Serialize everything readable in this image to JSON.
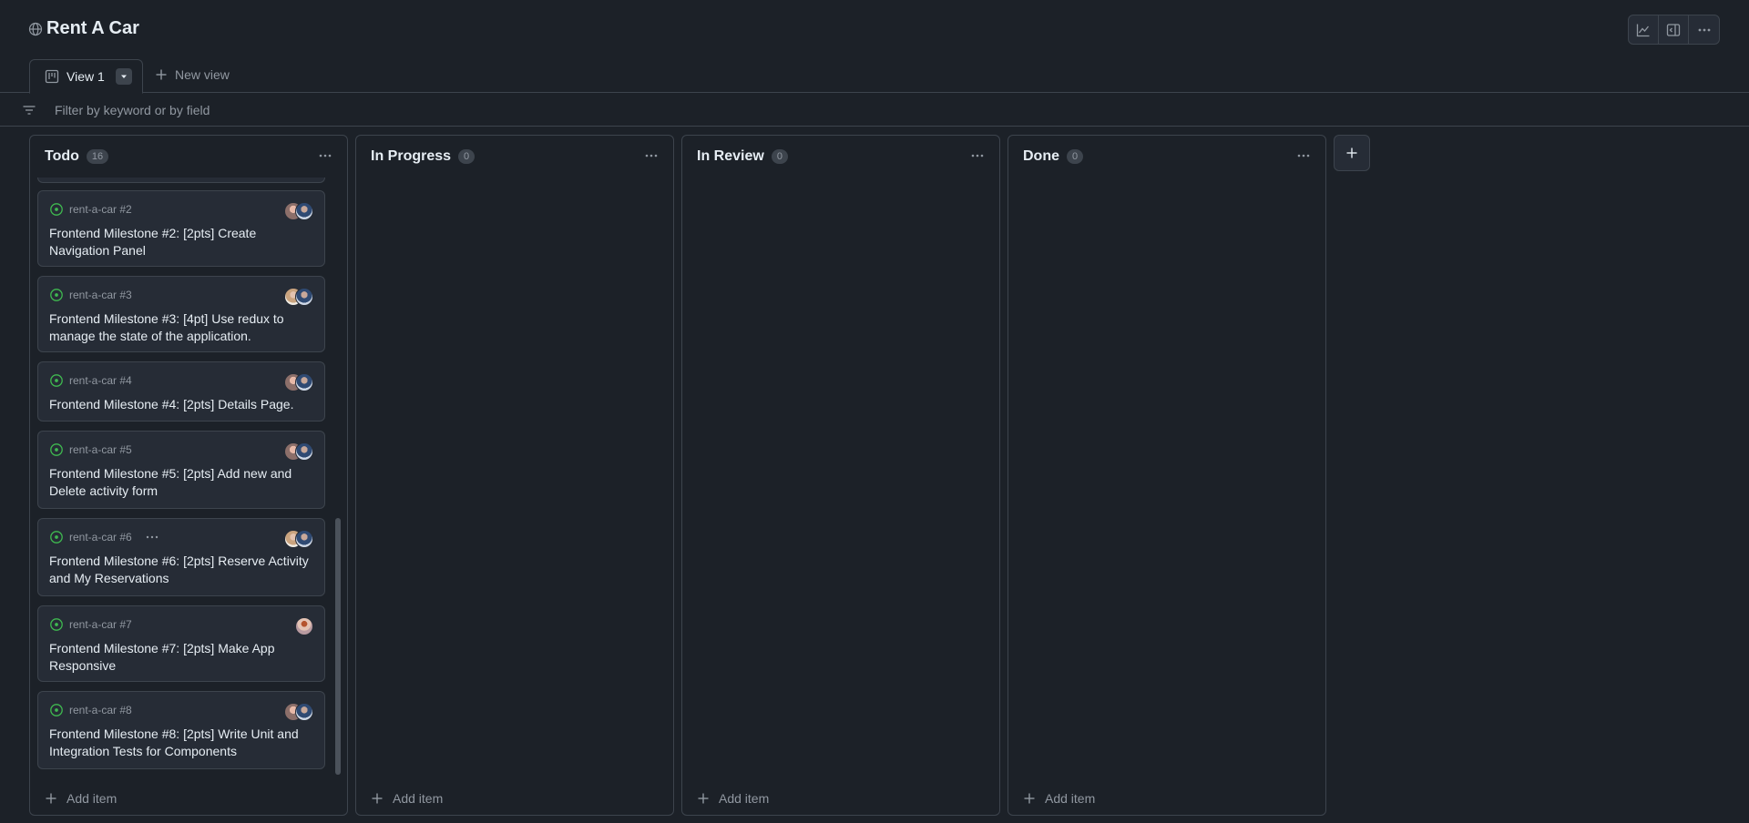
{
  "header": {
    "title": "Rent A Car",
    "icons": [
      "globe-icon",
      "graph-icon",
      "sidebar-icon",
      "kebab-horizontal-icon"
    ]
  },
  "tabs": {
    "active_label": "View 1",
    "new_view_label": "New view"
  },
  "filter": {
    "placeholder": "Filter by keyword or by field"
  },
  "columns": [
    {
      "name": "Todo",
      "count": "16",
      "add_label": "Add item",
      "cards": [
        {
          "ref": "rent-a-car #2",
          "title": "Frontend Milestone #2: [2pts] Create Navigation Panel",
          "avatars": [
            "a1",
            "a2"
          ]
        },
        {
          "ref": "rent-a-car #3",
          "title": "Frontend Milestone #3: [4pt] Use redux to manage the state of the application.",
          "avatars": [
            "a3",
            "a2"
          ]
        },
        {
          "ref": "rent-a-car #4",
          "title": "Frontend Milestone #4: [2pts] Details Page.",
          "avatars": [
            "a1",
            "a2"
          ]
        },
        {
          "ref": "rent-a-car #5",
          "title": "Frontend Milestone #5: [2pts] Add new and Delete activity form",
          "avatars": [
            "a1",
            "a2"
          ]
        },
        {
          "ref": "rent-a-car #6",
          "title": "Frontend Milestone #6: [2pts] Reserve Activity and My Reservations",
          "avatars": [
            "a3",
            "a2"
          ]
        },
        {
          "ref": "rent-a-car #7",
          "title": "Frontend Milestone #7: [2pts] Make App Responsive",
          "avatars": [
            "a4"
          ]
        },
        {
          "ref": "rent-a-car #8",
          "title": "Frontend Milestone #8: [2pts] Write Unit and Integration Tests for Components",
          "avatars": [
            "a1",
            "a2"
          ]
        }
      ]
    },
    {
      "name": "In Progress",
      "count": "0",
      "add_label": "Add item"
    },
    {
      "name": "In Review",
      "count": "0",
      "add_label": "Add item"
    },
    {
      "name": "Done",
      "count": "0",
      "add_label": "Add item"
    }
  ],
  "colors": {
    "background": "#1c2128",
    "card": "#262c36",
    "border": "#3d444d",
    "open_issue": "#3fb950",
    "muted": "#9198a1"
  }
}
